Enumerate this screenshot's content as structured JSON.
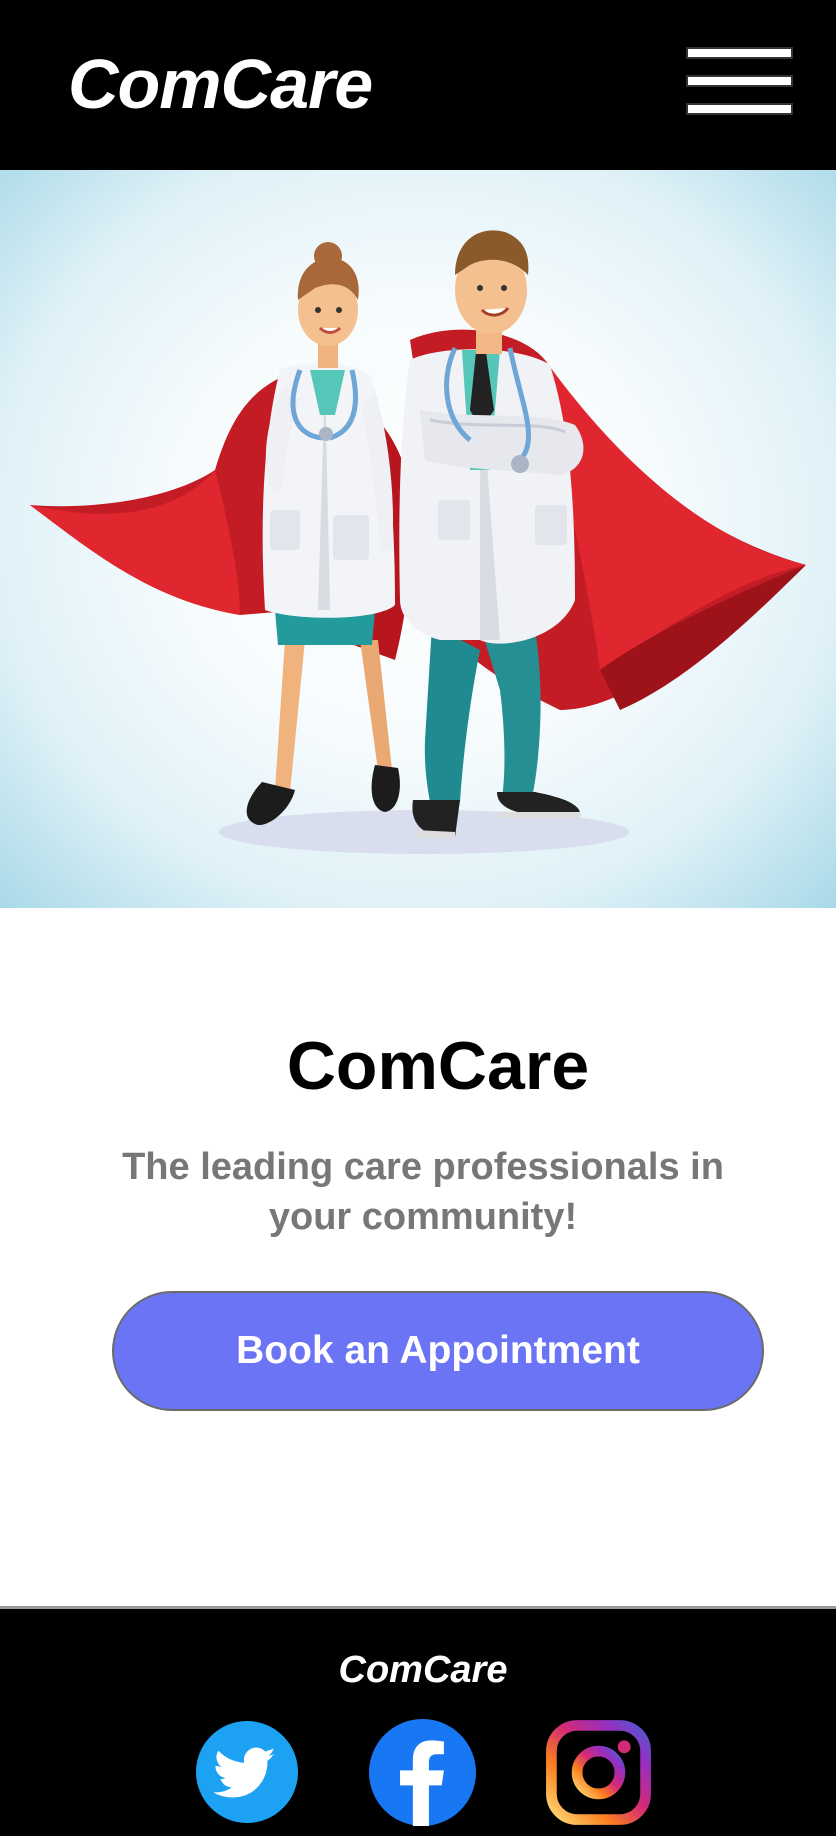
{
  "header": {
    "brand": "ComCare",
    "menu_icon": "hamburger-menu-icon"
  },
  "hero": {
    "image": "two cartoon doctors with red superhero capes"
  },
  "main": {
    "title": "ComCare",
    "tagline": "The leading care professionals in your community!",
    "cta_label": "Book an Appointment"
  },
  "footer": {
    "brand": "ComCare",
    "social": [
      {
        "icon": "twitter-icon"
      },
      {
        "icon": "facebook-icon"
      },
      {
        "icon": "instagram-icon"
      }
    ]
  },
  "colors": {
    "header_bg": "#000000",
    "cta_bg": "#6a74f5",
    "tagline": "#777777",
    "twitter": "#1da1f2",
    "facebook": "#1877f2"
  }
}
